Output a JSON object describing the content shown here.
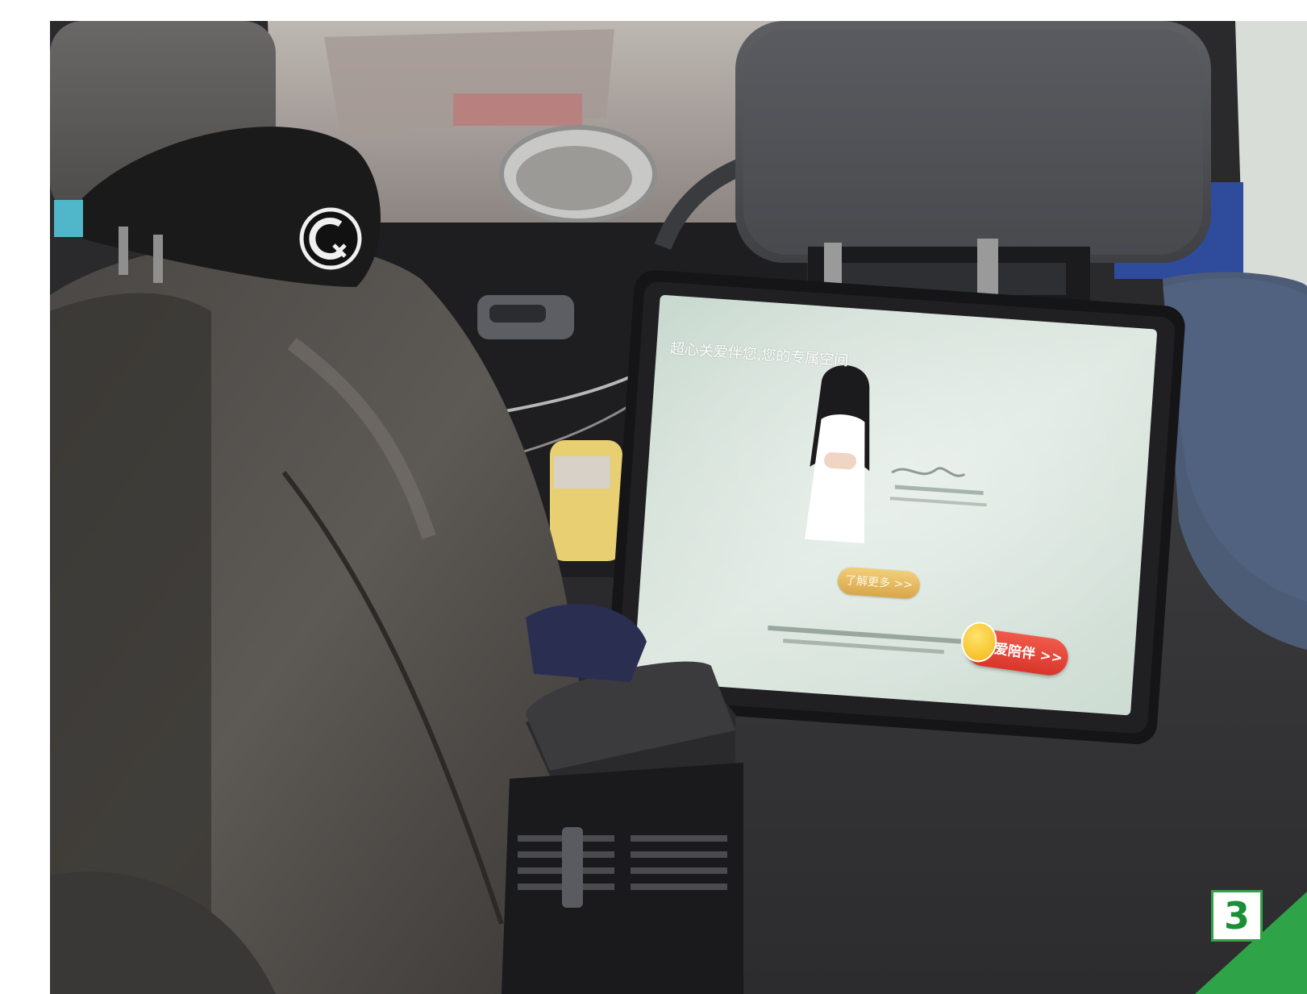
{
  "scene": {
    "tablet": {
      "caption_text": "超心关爱伴您,您的专属空间",
      "button_label": "了解更多 >>",
      "chat_label": "爱陪伴 >>",
      "chat_mascot_icon": "mascot-icon"
    },
    "headrest_logo_icon": "brand-logo-icon",
    "page_number": "3",
    "colors": {
      "badge_green": "#2fa347",
      "chat_red": "#e2473a",
      "button_gold": "#e4b85c",
      "screen_bg": "#dfe9e2"
    }
  }
}
